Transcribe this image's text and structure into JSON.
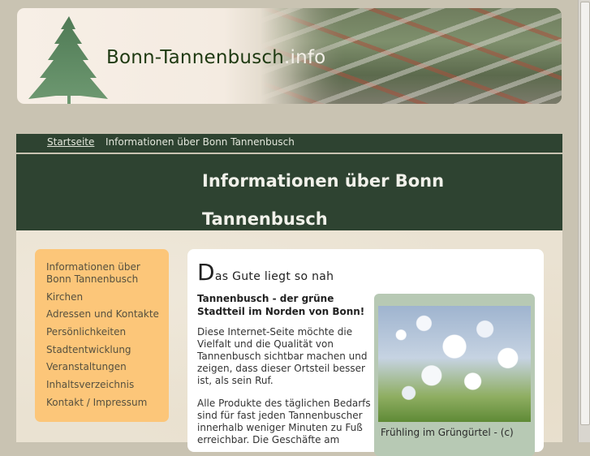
{
  "header": {
    "site_name": "Bonn-Tannenbusch",
    "site_tld": ".info"
  },
  "breadcrumb": {
    "home": "Startseite",
    "current": "Informationen über Bonn Tannenbusch"
  },
  "page_title": "Informationen über Bonn Tannenbusch",
  "sidebar": {
    "items": [
      {
        "label": "Informationen über Bonn Tannenbusch"
      },
      {
        "label": "Kirchen"
      },
      {
        "label": "Adressen und Kontakte"
      },
      {
        "label": "Persönlichkeiten"
      },
      {
        "label": "Stadtentwicklung"
      },
      {
        "label": "Veranstaltungen"
      },
      {
        "label": "Inhaltsverzeichnis"
      },
      {
        "label": "Kontakt / Impressum"
      }
    ]
  },
  "main": {
    "headline_cap": "D",
    "headline_rest": "as Gute liegt so nah",
    "subhead": "Tannenbusch - der grüne Stadtteil im Norden von Bonn!",
    "para1": "Diese Internet-Seite möchte die Vielfalt und die Qualität von Tannenbusch sichtbar machen und zeigen, dass dieser Ortsteil besser ist, als sein Ruf.",
    "para2": "Alle Produkte des täglichen Bedarfs sind für fast jeden Tannenbuscher innerhalb weniger Minuten zu Fuß erreichbar. Die Geschäfte am",
    "photo_caption": "Frühling im Grüngürtel - (c)"
  },
  "colors": {
    "dark_green": "#2e4331",
    "sidebar_orange": "#fcc679",
    "page_bg": "#c9c3b2"
  }
}
